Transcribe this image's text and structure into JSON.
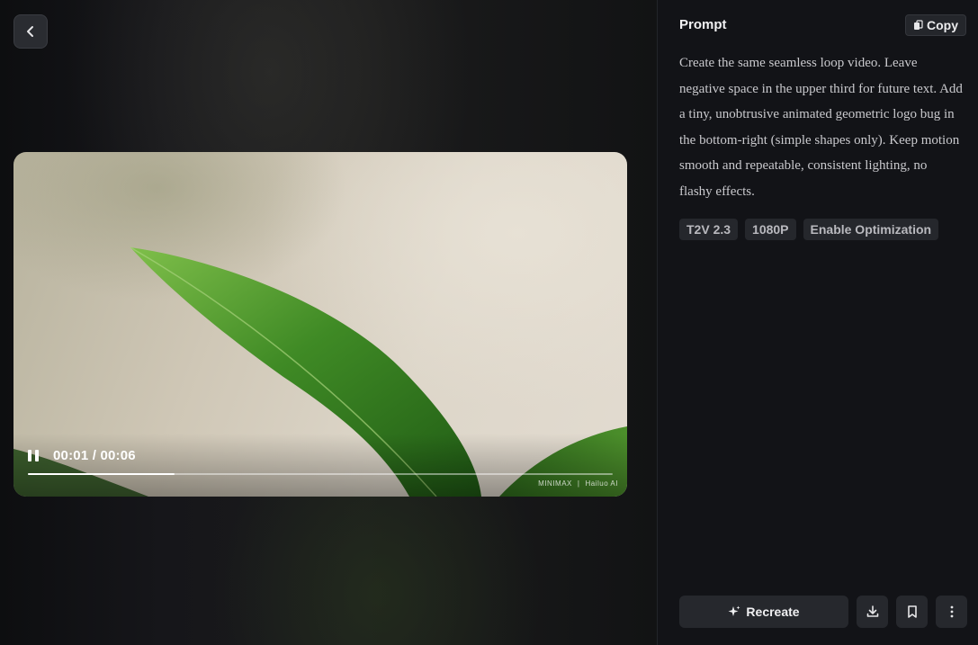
{
  "player": {
    "time_display": "00:01 / 00:06",
    "progress": 0.25,
    "watermark_brand": "MINIMAX",
    "watermark_product": "Hailuo AI"
  },
  "panel": {
    "title": "Prompt",
    "copy_label": "Copy",
    "prompt_text": "Create the same seamless loop video. Leave negative space in the upper third for future text. Add a tiny, unobtrusive animated geometric logo bug in the bottom-right (simple shapes only). Keep motion smooth and repeatable, consistent lighting, no flashy effects.",
    "tags": [
      "T2V 2.3",
      "1080P",
      "Enable Optimization"
    ],
    "recreate_label": "Recreate"
  },
  "icons": {
    "back": "chevron-left-icon",
    "copy": "copy-icon",
    "pause": "pause-icon",
    "recreate": "sparkle-icon",
    "download": "download-icon",
    "bookmark": "bookmark-icon",
    "more": "more-vertical-icon"
  }
}
